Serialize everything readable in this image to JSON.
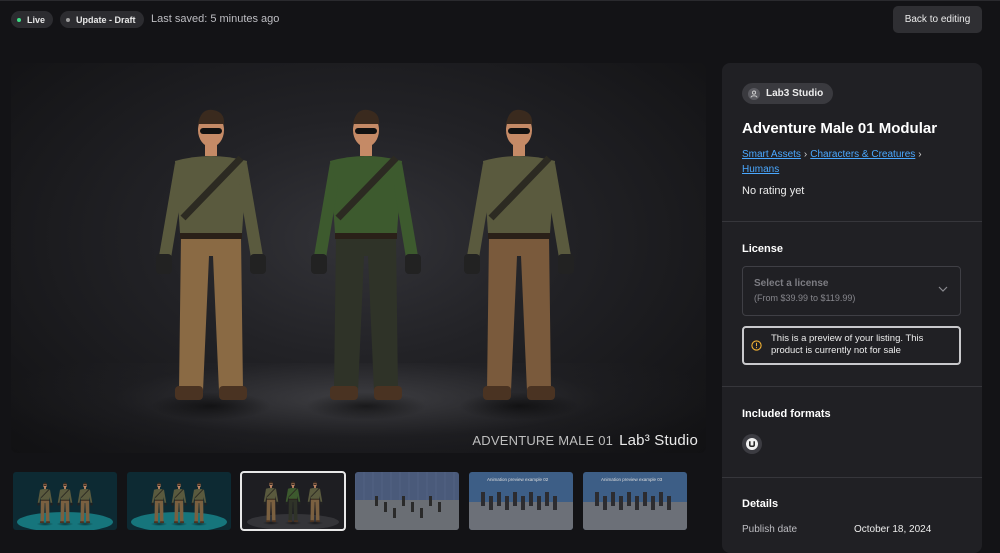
{
  "topbar": {
    "live_label": "Live",
    "update_label": "Update - Draft",
    "saved_text": "Last saved: 5 minutes ago",
    "back_label": "Back to editing",
    "live_dot_color": "#3ddc84",
    "update_dot_color": "#a0a0a0"
  },
  "hero": {
    "watermark_title": "ADVENTURE MALE 01",
    "watermark_brand": "Lab³ Studio",
    "figures": [
      {
        "shirt": "#5a5a3e",
        "pants": "#8a6a44"
      },
      {
        "shirt": "#3d5a2e",
        "pants": "#2f3328"
      },
      {
        "shirt": "#5a5a3e",
        "pants": "#7a5a3c"
      }
    ]
  },
  "thumbnails": [
    {
      "label": "",
      "style": "teal",
      "selected": false
    },
    {
      "label": "",
      "style": "teal",
      "selected": false
    },
    {
      "label": "",
      "style": "dark",
      "selected": true
    },
    {
      "label": "",
      "style": "grid",
      "selected": false
    },
    {
      "label": "Animation preview example 02",
      "style": "anim",
      "selected": false
    },
    {
      "label": "Animation preview example 03",
      "style": "anim",
      "selected": false
    }
  ],
  "panel": {
    "studio_name": "Lab3 Studio",
    "title": "Adventure Male 01 Modular",
    "breadcrumbs": [
      "Smart Assets",
      "Characters & Creatures",
      "Humans"
    ],
    "rating": "No rating yet",
    "license_heading": "License",
    "license_placeholder": "Select a license",
    "license_range": "(From $39.99 to $119.99)",
    "notice": "This is a preview of your listing. This product is currently not for sale",
    "formats_heading": "Included formats",
    "format_icon": "unreal-engine-icon",
    "details_heading": "Details",
    "publish_label": "Publish date",
    "publish_value": "October 18, 2024"
  }
}
